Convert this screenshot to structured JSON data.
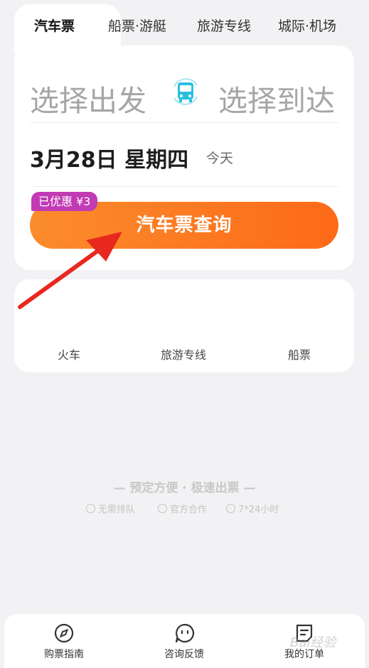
{
  "tabs": [
    {
      "label": "汽车票",
      "active": true
    },
    {
      "label": "船票·游艇",
      "active": false
    },
    {
      "label": "旅游专线",
      "active": false
    },
    {
      "label": "城际·机场",
      "active": false
    }
  ],
  "route": {
    "from_placeholder": "选择出发",
    "to_placeholder": "选择到达",
    "swap_icon": "bus-icon"
  },
  "date": {
    "value": "3月28日  星期四",
    "note": "今天"
  },
  "promo": {
    "label": "已优惠 ¥3"
  },
  "search_button": {
    "label": "汽车票查询"
  },
  "quick_links": [
    {
      "label": "火车"
    },
    {
      "label": "旅游专线"
    },
    {
      "label": "船票"
    }
  ],
  "slogan": {
    "title": "— 预定方便 · 极速出票 —",
    "features": [
      "无需排队",
      "官方合作",
      "7*24小时"
    ]
  },
  "bottom_nav": [
    {
      "label": "购票指南",
      "icon": "compass-icon"
    },
    {
      "label": "咨询反馈",
      "icon": "chat-icon"
    },
    {
      "label": "我的订单",
      "icon": "order-icon"
    }
  ],
  "watermark": "Bai经验",
  "colors": {
    "accent": "#fd6a18",
    "promo": "#c23ab4",
    "bus_icon": "#28c0e0"
  }
}
